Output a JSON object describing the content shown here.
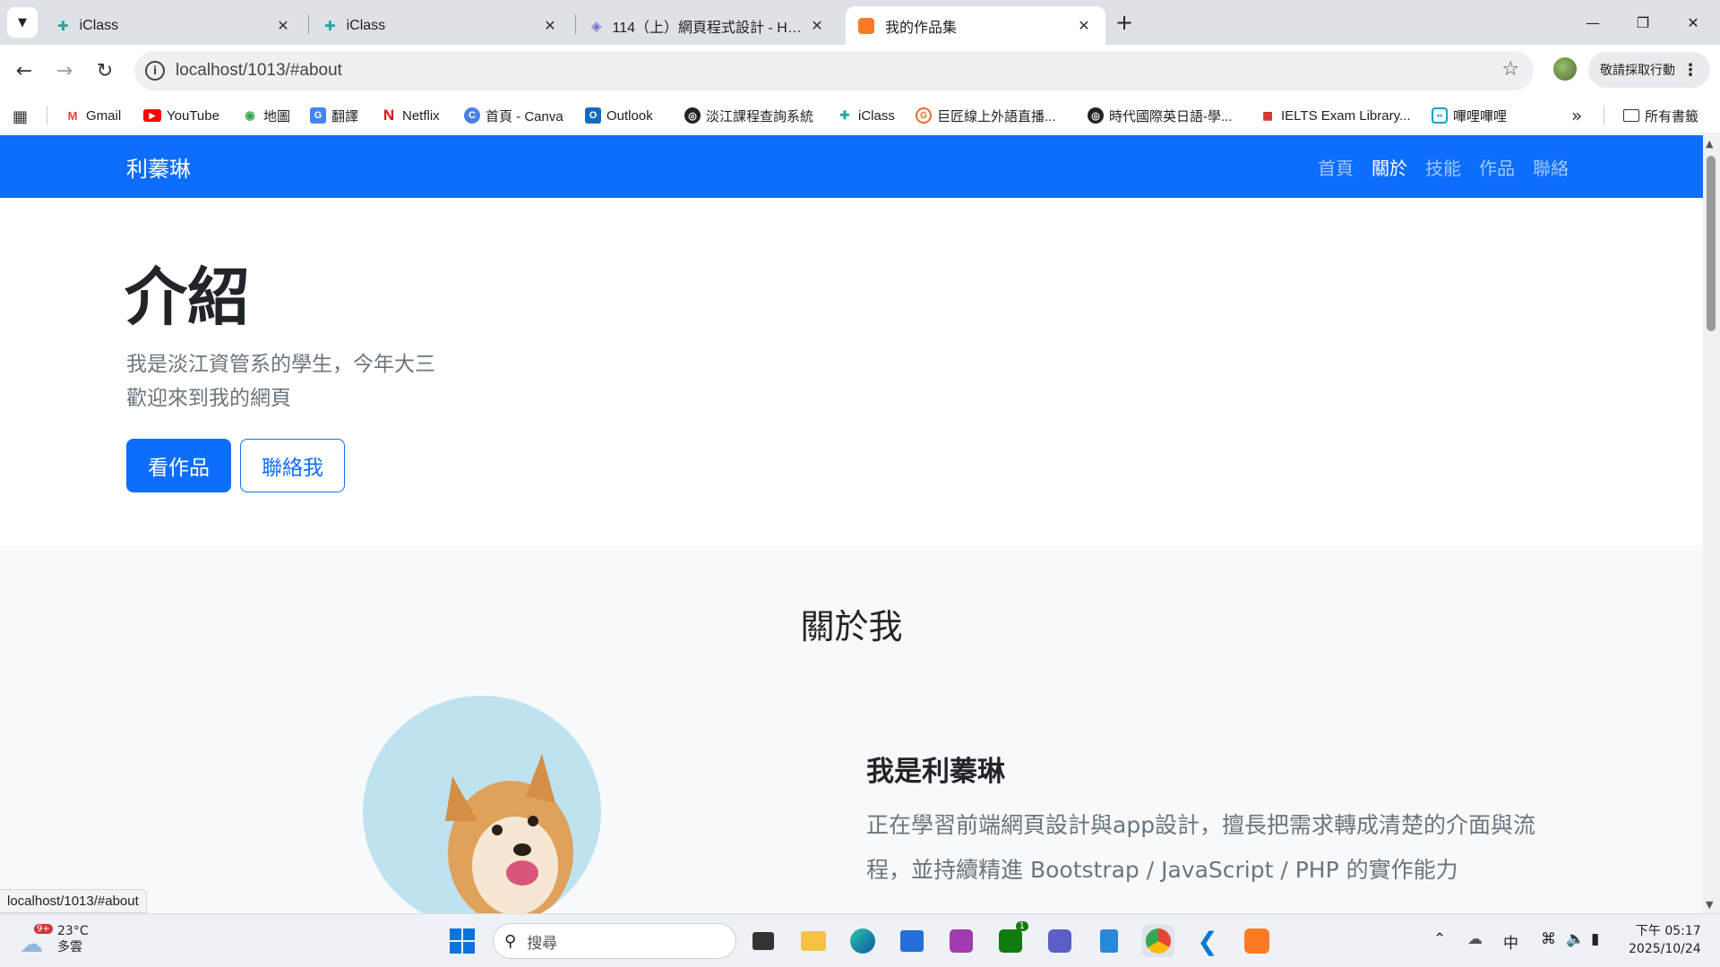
{
  "tabs": [
    {
      "title": "iClass"
    },
    {
      "title": "iClass"
    },
    {
      "title": "114（上）網頁程式設計 - Hack"
    },
    {
      "title": "我的作品集"
    }
  ],
  "toolbar": {
    "url": "localhost/1013/#about",
    "action_button": "敬請採取行動"
  },
  "bookmarks": [
    {
      "label": "Gmail"
    },
    {
      "label": "YouTube"
    },
    {
      "label": "地圖"
    },
    {
      "label": "翻譯"
    },
    {
      "label": "Netflix"
    },
    {
      "label": "首頁 - Canva"
    },
    {
      "label": "Outlook"
    },
    {
      "label": "淡江課程查詢系統"
    },
    {
      "label": "iClass"
    },
    {
      "label": "巨匠線上外語直播..."
    },
    {
      "label": "時代國際英日語-學..."
    },
    {
      "label": "IELTS Exam Library..."
    },
    {
      "label": "嗶哩嗶哩"
    }
  ],
  "all_bookmarks": "所有書籤",
  "site": {
    "brand": "利蓁琳",
    "nav": [
      "首頁",
      "關於",
      "技能",
      "作品",
      "聯絡"
    ],
    "hero": {
      "title": "介紹",
      "lead_1": "我是淡江資管系的學生，今年大三",
      "lead_2": "歡迎來到我的網頁",
      "btn_primary": "看作品",
      "btn_secondary": "聯絡我"
    },
    "about": {
      "heading": "關於我",
      "name": "我是利蓁琳",
      "text_1": "正在學習前端網頁設計與app設計，擅長把需求轉成清楚的介面與流",
      "text_2": "程，並持續精進 Bootstrap / JavaScript / PHP 的實作能力"
    }
  },
  "status_url": "localhost/1013/#about",
  "taskbar": {
    "temp": "23°C",
    "weather": "多雲",
    "weather_badge": "9+",
    "search": "搜尋",
    "xbox_badge": "1",
    "ime": "中",
    "time": "下午 05:17",
    "date": "2025/10/24"
  },
  "colors": {
    "primary": "#0d6efd",
    "muted": "#6c757d",
    "about_bg": "#f8f9fa"
  }
}
